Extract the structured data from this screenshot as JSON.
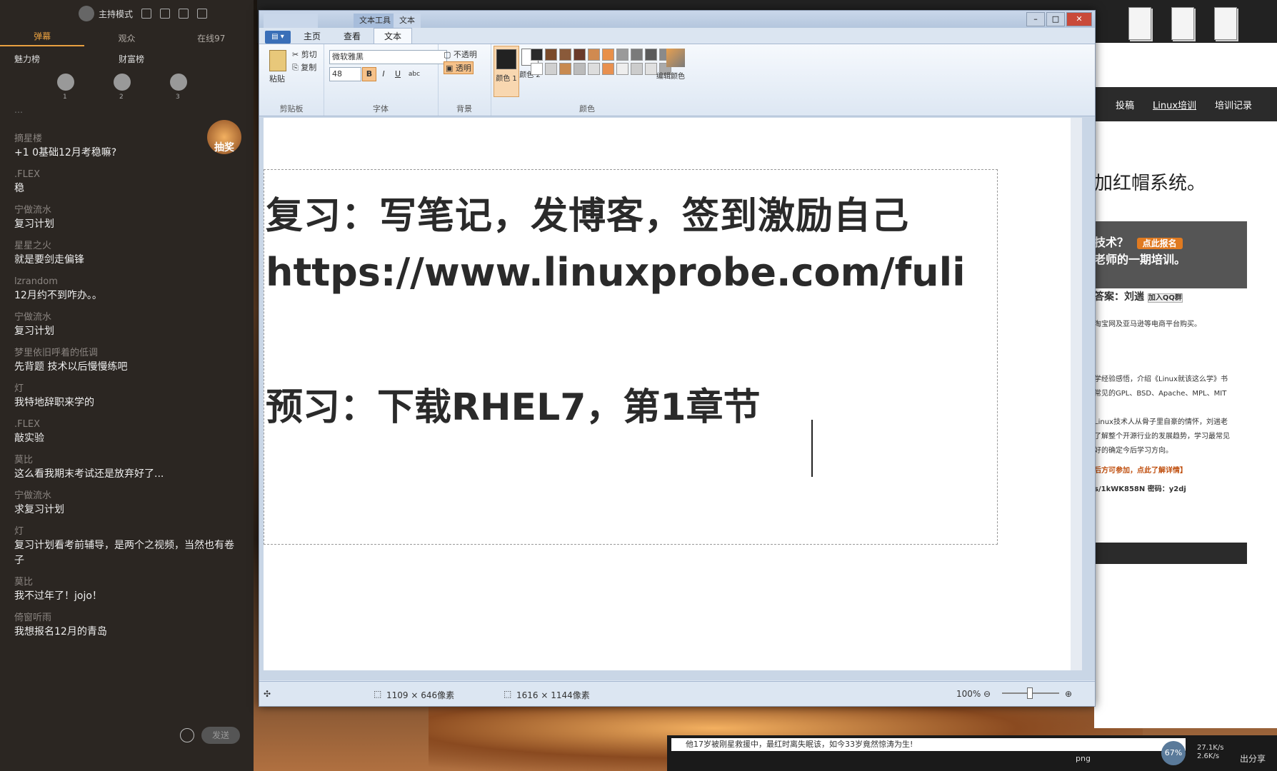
{
  "chat": {
    "mode_title": "主持模式",
    "tabs": [
      "弹幕",
      "观众",
      "在线97"
    ],
    "rank_tabs": [
      "魅力榜",
      "财富榜"
    ],
    "rank_numbers": [
      "1",
      "2",
      "3"
    ],
    "faded_line": "…",
    "lottery_label": "抽奖",
    "send_label": "发送",
    "messages": [
      {
        "user": "摘星楼",
        "text": "+1 0基础12月考稳嘛?"
      },
      {
        "user": ".FLEX",
        "text": "稳"
      },
      {
        "user": "宁做流水",
        "text": "复习计划"
      },
      {
        "user": "星星之火",
        "text": "就是要剑走偏锋"
      },
      {
        "user": "lzrandom",
        "text": "12月约不到咋办。。"
      },
      {
        "user": "宁做流水",
        "text": "复习计划"
      },
      {
        "user": "梦里依旧呼着的低调",
        "text": "先背题 技术以后慢慢练吧"
      },
      {
        "user": "灯",
        "text": "我特地辞职来学的"
      },
      {
        "user": ".FLEX",
        "text": "敲实验"
      },
      {
        "user": "莫比",
        "text": "这么看我期末考试还是放弃好了..."
      },
      {
        "user": "宁做流水",
        "text": "求复习计划"
      },
      {
        "user": "灯",
        "text": "复习计划看考前辅导，是两个之视频，当然也有卷子"
      },
      {
        "user": "莫比",
        "text": "我不过年了！jojo！"
      },
      {
        "user": "倚窗听雨",
        "text": "我想报名12月的青岛"
      }
    ]
  },
  "paint": {
    "context_tab": "文本工具",
    "context_tab2": "文本",
    "menu_button": "▤ ▾",
    "ribbon_tabs": [
      "主页",
      "查看",
      "文本"
    ],
    "clipboard": {
      "paste": "粘贴",
      "cut": "剪切",
      "copy": "复制",
      "label": "剪贴板"
    },
    "font": {
      "family": "微软雅黑",
      "size": "48",
      "label": "字体",
      "bold": "B",
      "italic": "I",
      "underline": "U",
      "strike": "abc"
    },
    "background": {
      "opaque": "不透明",
      "transparent": "透明",
      "label": "背景"
    },
    "colors": {
      "color1": "颜色 1",
      "color2": "颜色 2",
      "label": "颜色",
      "edit": "编辑颜色",
      "color1_hex": "#222222",
      "color2_hex": "#ffffff"
    },
    "palette": [
      "#2a2a2a",
      "#7a4a2a",
      "#8a5a3a",
      "#6a3a2a",
      "#d08a50",
      "#e8904a",
      "#9a9a9a",
      "#7a7a7a",
      "#5a5a5a",
      "#8a8a8a",
      "#ffffff",
      "#d0d0d0",
      "#c88a50",
      "#bbbbbb",
      "#dddddd",
      "#e89050",
      "#eeeeee",
      "#cccccc",
      "#e0e0e0",
      "#aaaaaa"
    ],
    "canvas_lines": [
      "复习：写笔记，发博客，签到激励自己",
      "https://www.linuxprobe.com/fuli",
      "预习：下载RHEL7，第1章节"
    ],
    "status": {
      "selection": "1109 × 646像素",
      "image_size": "1616 × 1144像素",
      "zoom": "100%"
    }
  },
  "browser": {
    "nav": [
      "投稿",
      "Linux培训",
      "培训记录"
    ],
    "heading": "加红帽系统。",
    "banner_line1": "技术？",
    "banner_tag": "点此报名",
    "banner_line2": "老师的一期培训。",
    "answer": "答案：刘遄",
    "qq": "加入QQ群",
    "buy": "淘宝网及亚马逊等电商平台购买。",
    "desc1": "学经验感悟，介绍《Linux就该这么学》书",
    "desc2": "常见的GPL、BSD、Apache、MPL、MIT",
    "desc3": "Linux技术人从骨子里自豪的情怀，刘遄老",
    "desc4": "了解整个开源行业的发展趋势，学习最常见",
    "desc5": "好的确定今后学习方向。",
    "join": "后方可参加，点此了解详情】",
    "pan": "s/1kWK858N 密码：y2dj"
  },
  "taskbar": {
    "notification": "他17岁被刚星救援中，最红时离失眠该，如今33岁竟然惊涛为生!",
    "cpu": "67%",
    "up": "27.1K/s",
    "down": "2.6K/s",
    "share": "出分享",
    "png": "png"
  }
}
